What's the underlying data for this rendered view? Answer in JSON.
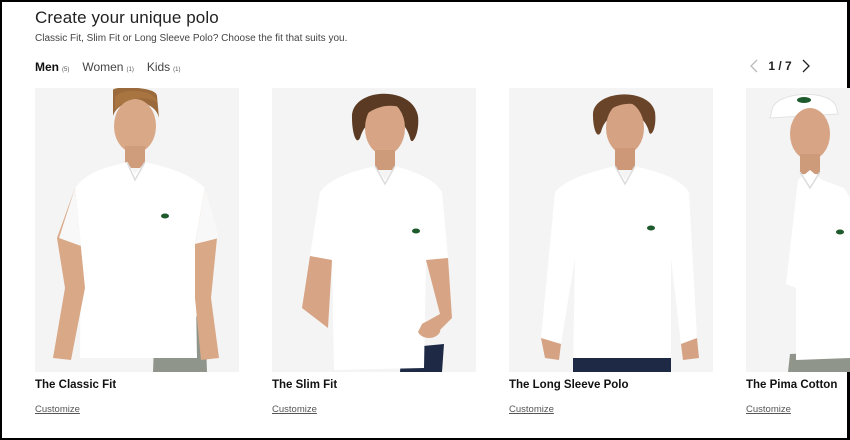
{
  "header": {
    "title": "Create your unique polo",
    "subtitle": "Classic Fit, Slim Fit or Long Sleeve Polo? Choose the fit that suits you."
  },
  "tabs": [
    {
      "label": "Men",
      "count": "(5)",
      "active": true
    },
    {
      "label": "Women",
      "count": "(1)",
      "active": false
    },
    {
      "label": "Kids",
      "count": "(1)",
      "active": false
    }
  ],
  "pager": {
    "text": "1 / 7",
    "prev_icon": "chevron-left-icon",
    "next_icon": "chevron-right-icon"
  },
  "products": [
    {
      "name": "The Classic Fit",
      "link": "Customize"
    },
    {
      "name": "The Slim Fit",
      "link": "Customize"
    },
    {
      "name": "The Long Sleeve Polo",
      "link": "Customize"
    },
    {
      "name": "The Pima Cotton",
      "link": "Customize"
    }
  ],
  "colors": {
    "polo": "#ffffff",
    "image_bg": "#f4f4f4",
    "logo": "#1d5a2c"
  }
}
